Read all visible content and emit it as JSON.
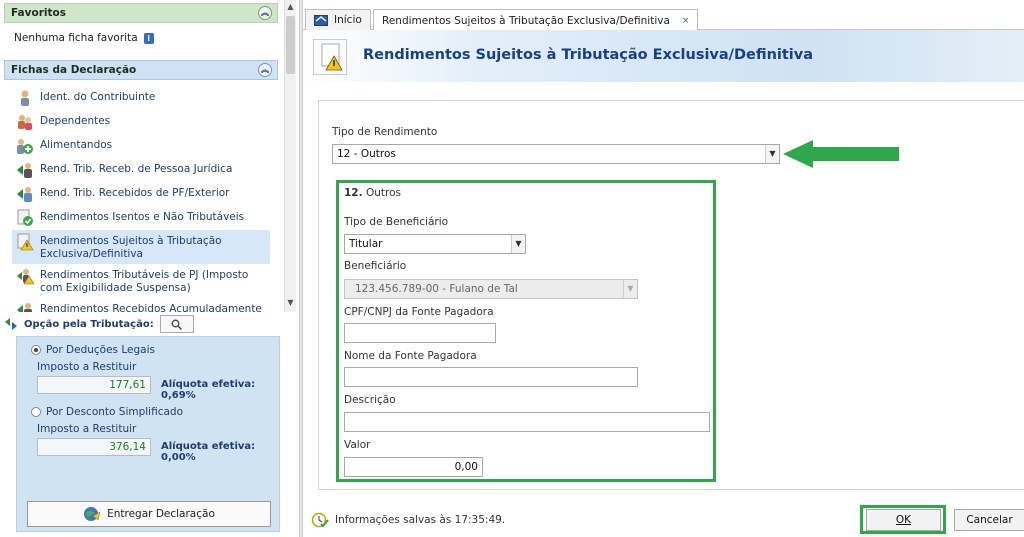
{
  "sidebar": {
    "favoritos": {
      "title": "Favoritos",
      "empty_text": "Nenhuma ficha favorita"
    },
    "fichas": {
      "title": "Fichas da Declaração",
      "items": [
        {
          "label": "Ident. do Contribuinte",
          "icon": "person-icon"
        },
        {
          "label": "Dependentes",
          "icon": "dependents-icon"
        },
        {
          "label": "Alimentandos",
          "icon": "alimentandos-icon"
        },
        {
          "label": "Rend. Trib. Receb. de Pessoa Jurídica",
          "icon": "income-pj-icon"
        },
        {
          "label": "Rend. Trib. Recebidos de PF/Exterior",
          "icon": "income-pf-icon"
        },
        {
          "label": "Rendimentos Isentos e Não Tributáveis",
          "icon": "exempt-income-icon"
        },
        {
          "label": "Rendimentos Sujeitos à Tributação Exclusiva/Definitiva",
          "icon": "warning-doc-icon",
          "selected": true
        },
        {
          "label": "Rendimentos Tributáveis de PJ (Imposto com Exigibilidade Suspensa)",
          "icon": "suspended-income-icon"
        },
        {
          "label": "Rendimentos Recebidos Acumuladamente",
          "icon": "accumulated-income-icon"
        }
      ]
    },
    "opcao": {
      "label": "Opção pela Tributação:",
      "deducoes_label": "Por Deduções Legais",
      "imposto_label_1": "Imposto a Restituir",
      "imposto_value_1": "177,61",
      "aliquota_1": "Alíquota efetiva: 0,69%",
      "simplificado_label": "Por Desconto Simplificado",
      "imposto_label_2": "Imposto a Restituir",
      "imposto_value_2": "376,14",
      "aliquota_2": "Alíquota efetiva: 0,00%",
      "selected": "deducoes"
    },
    "entregar_label": "Entregar Declaração"
  },
  "tabs": [
    {
      "label": "Início",
      "icon": "home-icon"
    },
    {
      "label": "Rendimentos Sujeitos à Tributação Exclusiva/Definitiva",
      "close": "×"
    }
  ],
  "page": {
    "title": "Rendimentos Sujeitos à Tributação Exclusiva/Definitiva"
  },
  "form": {
    "tipo_rendimento_label": "Tipo de Rendimento",
    "tipo_rendimento_value": "12 - Outros",
    "section_number": "12.",
    "section_title": "Outros",
    "tipo_beneficiario_label": "Tipo de Beneficiário",
    "tipo_beneficiario_value": "Titular",
    "beneficiario_label": "Beneficiário",
    "beneficiario_value": "123.456.789-00 - Fulano de Tal",
    "cpf_label": "CPF/CNPJ da Fonte Pagadora",
    "cpf_value": "",
    "nome_label": "Nome da Fonte Pagadora",
    "nome_value": "",
    "descricao_label": "Descrição",
    "descricao_value": "",
    "valor_label": "Valor",
    "valor_value": "0,00"
  },
  "footer": {
    "status": "Informações salvas às 17:35:49.",
    "ok_label": "OK",
    "cancel_label": "Cancelar"
  },
  "colors": {
    "highlight_green": "#2ea84a",
    "title_blue": "#14418a",
    "value_green": "#1f7a1f"
  }
}
